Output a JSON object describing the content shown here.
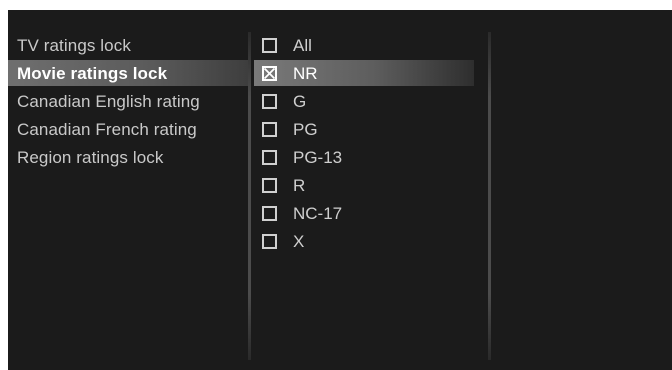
{
  "menu": {
    "items": [
      {
        "label": "TV ratings lock",
        "selected": false
      },
      {
        "label": "Movie ratings lock",
        "selected": true
      },
      {
        "label": "Canadian English rating",
        "selected": false
      },
      {
        "label": "Canadian French rating",
        "selected": false
      },
      {
        "label": "Region ratings lock",
        "selected": false
      }
    ]
  },
  "options": {
    "items": [
      {
        "label": "All",
        "checked": false
      },
      {
        "label": "NR",
        "checked": true
      },
      {
        "label": "G",
        "checked": false
      },
      {
        "label": "PG",
        "checked": false
      },
      {
        "label": "PG-13",
        "checked": false
      },
      {
        "label": "R",
        "checked": false
      },
      {
        "label": "NC-17",
        "checked": false
      },
      {
        "label": "X",
        "checked": false
      }
    ]
  },
  "colors": {
    "background": "#1b1b1b",
    "highlight": "#6f6f6f",
    "text": "#c9c9c9",
    "selected_text": "#ffffff"
  }
}
